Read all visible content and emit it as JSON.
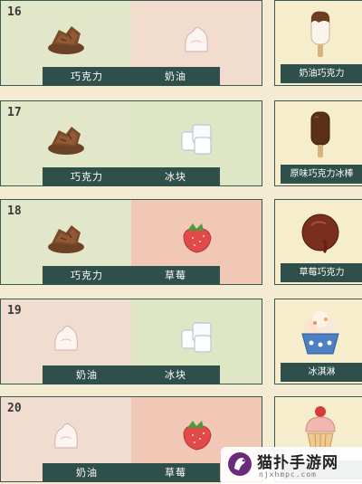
{
  "recipes": [
    {
      "number": "16",
      "ingredients": [
        {
          "name": "巧克力",
          "icon": "chocolate-icon"
        },
        {
          "name": "奶油",
          "icon": "cream-icon"
        }
      ],
      "result": {
        "name": "奶油巧克力",
        "icon": "cream-chocolate-popsicle-icon"
      }
    },
    {
      "number": "17",
      "ingredients": [
        {
          "name": "巧克力",
          "icon": "chocolate-icon"
        },
        {
          "name": "冰块",
          "icon": "ice-cube-icon"
        }
      ],
      "result": {
        "name": "原味巧克力冰棒",
        "icon": "chocolate-popsicle-icon"
      }
    },
    {
      "number": "18",
      "ingredients": [
        {
          "name": "巧克力",
          "icon": "chocolate-icon"
        },
        {
          "name": "草莓",
          "icon": "strawberry-icon"
        }
      ],
      "result": {
        "name": "草莓巧克力",
        "icon": "strawberry-chocolate-icon"
      }
    },
    {
      "number": "19",
      "ingredients": [
        {
          "name": "奶油",
          "icon": "cream-icon"
        },
        {
          "name": "冰块",
          "icon": "ice-cube-icon"
        }
      ],
      "result": {
        "name": "冰淇淋",
        "icon": "ice-cream-cup-icon"
      }
    },
    {
      "number": "20",
      "ingredients": [
        {
          "name": "奶油",
          "icon": "cream-icon"
        },
        {
          "name": "草莓",
          "icon": "strawberry-icon"
        }
      ],
      "result": {
        "name": "",
        "icon": "strawberry-cupcake-icon"
      }
    }
  ],
  "watermark": {
    "title": "猫扑手游网",
    "url": "njxhmpc.com",
    "logo": "watermark-logo-icon"
  },
  "colors": {
    "bar": "#2f4f4a",
    "border": "#3c5a54",
    "page": "#f4ecd2"
  }
}
